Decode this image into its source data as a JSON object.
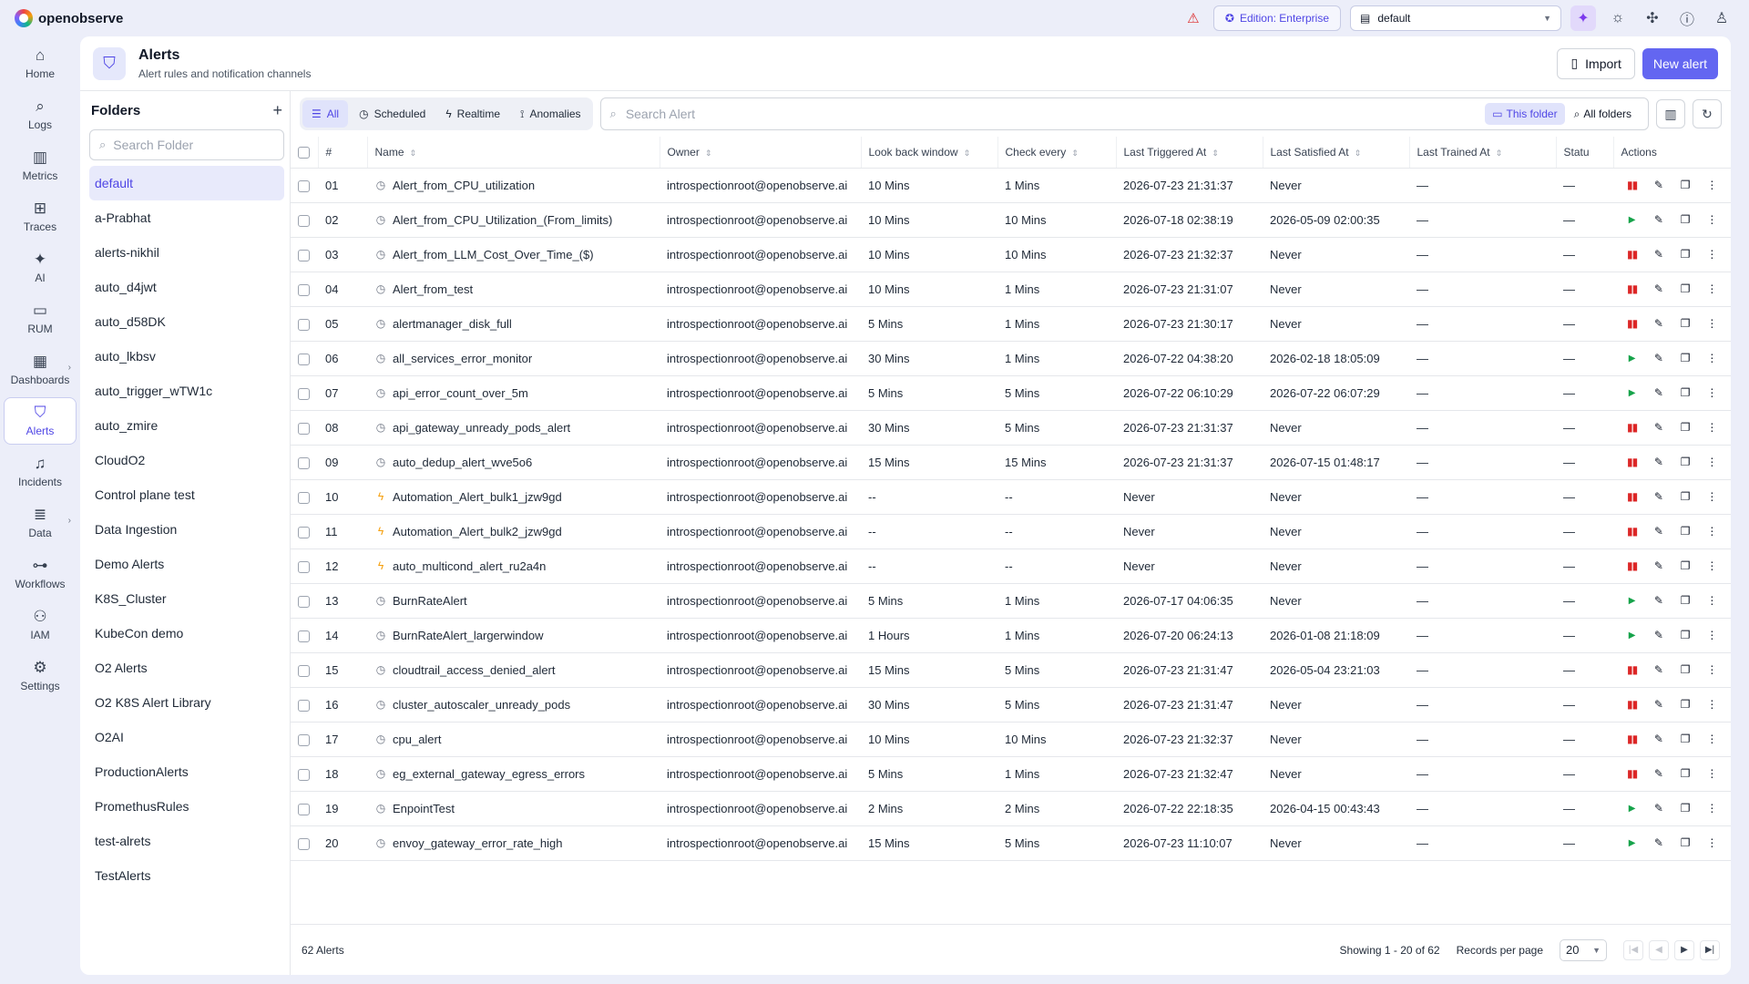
{
  "app": {
    "name": "openobserve"
  },
  "topbar": {
    "edition": "Edition: Enterprise",
    "org": "default"
  },
  "nav": [
    {
      "key": "home",
      "label": "Home",
      "icon": "home-icon",
      "glyph": "⌂",
      "active": false,
      "more": false
    },
    {
      "key": "logs",
      "label": "Logs",
      "icon": "search-icon",
      "glyph": "⌕",
      "active": false,
      "more": false
    },
    {
      "key": "metrics",
      "label": "Metrics",
      "icon": "bar-chart-icon",
      "glyph": "▥",
      "active": false,
      "more": false
    },
    {
      "key": "traces",
      "label": "Traces",
      "icon": "traces-icon",
      "glyph": "⊞",
      "active": false,
      "more": false
    },
    {
      "key": "ai",
      "label": "AI",
      "icon": "sparkle-icon",
      "glyph": "✦",
      "active": false,
      "more": false
    },
    {
      "key": "rum",
      "label": "RUM",
      "icon": "devices-icon",
      "glyph": "▭",
      "active": false,
      "more": false
    },
    {
      "key": "dashboards",
      "label": "Dashboards",
      "icon": "dashboard-icon",
      "glyph": "▦",
      "active": false,
      "more": true
    },
    {
      "key": "alerts",
      "label": "Alerts",
      "icon": "shield-icon",
      "glyph": "⛉",
      "active": true,
      "more": false
    },
    {
      "key": "incidents",
      "label": "Incidents",
      "icon": "bell-icon",
      "glyph": "♫",
      "active": false,
      "more": false
    },
    {
      "key": "data",
      "label": "Data",
      "icon": "database-icon",
      "glyph": "≣",
      "active": false,
      "more": true
    },
    {
      "key": "workflows",
      "label": "Workflows",
      "icon": "workflow-icon",
      "glyph": "⊶",
      "active": false,
      "more": false
    },
    {
      "key": "iam",
      "label": "IAM",
      "icon": "users-icon",
      "glyph": "⚇",
      "active": false,
      "more": false
    },
    {
      "key": "settings",
      "label": "Settings",
      "icon": "gear-icon",
      "glyph": "⚙",
      "active": false,
      "more": false
    }
  ],
  "header": {
    "title": "Alerts",
    "subtitle": "Alert rules and notification channels",
    "import_label": "Import",
    "new_label": "New alert"
  },
  "folders": {
    "title": "Folders",
    "search_placeholder": "Search Folder",
    "items": [
      "default",
      "a-Prabhat",
      "alerts-nikhil",
      "auto_d4jwt",
      "auto_d58DK",
      "auto_lkbsv",
      "auto_trigger_wTW1c",
      "auto_zmire",
      "CloudO2",
      "Control plane test",
      "Data Ingestion",
      "Demo Alerts",
      "K8S_Cluster",
      "KubeCon demo",
      "O2 Alerts",
      "O2 K8S Alert Library",
      "O2AI",
      "ProductionAlerts",
      "PromethusRules",
      "test-alrets",
      "TestAlerts"
    ],
    "selected": "default"
  },
  "toolbar": {
    "tabs": [
      {
        "label": "All",
        "icon": "list-icon",
        "glyph": "☰",
        "active": true
      },
      {
        "label": "Scheduled",
        "icon": "clock-icon",
        "glyph": "◷",
        "active": false
      },
      {
        "label": "Realtime",
        "icon": "bolt-icon",
        "glyph": "ϟ",
        "active": false
      },
      {
        "label": "Anomalies",
        "icon": "anomaly-icon",
        "glyph": "⟟",
        "active": false
      }
    ],
    "search_placeholder": "Search Alert",
    "scope_this": "This folder",
    "scope_all": "All folders"
  },
  "table": {
    "headers": {
      "num": "#",
      "name": "Name",
      "owner": "Owner",
      "lookback": "Look back window",
      "check": "Check every",
      "triggered": "Last Triggered At",
      "satisfied": "Last Satisfied At",
      "trained": "Last Trained At",
      "status": "Statu",
      "actions": "Actions"
    },
    "rows": [
      {
        "num": "01",
        "type": "scheduled",
        "name": "Alert_from_CPU_utilization",
        "owner": "introspectionroot@openobserve.ai",
        "lookback": "10 Mins",
        "check": "1 Mins",
        "triggered": "2026-07-23 21:31:37",
        "satisfied": "Never",
        "trained": "—",
        "status": "—",
        "state": "running"
      },
      {
        "num": "02",
        "type": "scheduled",
        "name": "Alert_from_CPU_Utilization_(From_limits)",
        "owner": "introspectionroot@openobserve.ai",
        "lookback": "10 Mins",
        "check": "10 Mins",
        "triggered": "2026-07-18 02:38:19",
        "satisfied": "2026-05-09 02:00:35",
        "trained": "—",
        "status": "—",
        "state": "paused"
      },
      {
        "num": "03",
        "type": "scheduled",
        "name": "Alert_from_LLM_Cost_Over_Time_($)",
        "owner": "introspectionroot@openobserve.ai",
        "lookback": "10 Mins",
        "check": "10 Mins",
        "triggered": "2026-07-23 21:32:37",
        "satisfied": "Never",
        "trained": "—",
        "status": "—",
        "state": "running"
      },
      {
        "num": "04",
        "type": "scheduled",
        "name": "Alert_from_test",
        "owner": "introspectionroot@openobserve.ai",
        "lookback": "10 Mins",
        "check": "1 Mins",
        "triggered": "2026-07-23 21:31:07",
        "satisfied": "Never",
        "trained": "—",
        "status": "—",
        "state": "running"
      },
      {
        "num": "05",
        "type": "scheduled",
        "name": "alertmanager_disk_full",
        "owner": "introspectionroot@openobserve.ai",
        "lookback": "5 Mins",
        "check": "1 Mins",
        "triggered": "2026-07-23 21:30:17",
        "satisfied": "Never",
        "trained": "—",
        "status": "—",
        "state": "running"
      },
      {
        "num": "06",
        "type": "scheduled",
        "name": "all_services_error_monitor",
        "owner": "introspectionroot@openobserve.ai",
        "lookback": "30 Mins",
        "check": "1 Mins",
        "triggered": "2026-07-22 04:38:20",
        "satisfied": "2026-02-18 18:05:09",
        "trained": "—",
        "status": "—",
        "state": "paused"
      },
      {
        "num": "07",
        "type": "scheduled",
        "name": "api_error_count_over_5m",
        "owner": "introspectionroot@openobserve.ai",
        "lookback": "5 Mins",
        "check": "5 Mins",
        "triggered": "2026-07-22 06:10:29",
        "satisfied": "2026-07-22 06:07:29",
        "trained": "—",
        "status": "—",
        "state": "paused"
      },
      {
        "num": "08",
        "type": "scheduled",
        "name": "api_gateway_unready_pods_alert",
        "owner": "introspectionroot@openobserve.ai",
        "lookback": "30 Mins",
        "check": "5 Mins",
        "triggered": "2026-07-23 21:31:37",
        "satisfied": "Never",
        "trained": "—",
        "status": "—",
        "state": "running"
      },
      {
        "num": "09",
        "type": "scheduled",
        "name": "auto_dedup_alert_wve5o6",
        "owner": "introspectionroot@openobserve.ai",
        "lookback": "15 Mins",
        "check": "15 Mins",
        "triggered": "2026-07-23 21:31:37",
        "satisfied": "2026-07-15 01:48:17",
        "trained": "—",
        "status": "—",
        "state": "running"
      },
      {
        "num": "10",
        "type": "realtime",
        "name": "Automation_Alert_bulk1_jzw9gd",
        "owner": "introspectionroot@openobserve.ai",
        "lookback": "--",
        "check": "--",
        "triggered": "Never",
        "satisfied": "Never",
        "trained": "—",
        "status": "—",
        "state": "running"
      },
      {
        "num": "11",
        "type": "realtime",
        "name": "Automation_Alert_bulk2_jzw9gd",
        "owner": "introspectionroot@openobserve.ai",
        "lookback": "--",
        "check": "--",
        "triggered": "Never",
        "satisfied": "Never",
        "trained": "—",
        "status": "—",
        "state": "running"
      },
      {
        "num": "12",
        "type": "realtime",
        "name": "auto_multicond_alert_ru2a4n",
        "owner": "introspectionroot@openobserve.ai",
        "lookback": "--",
        "check": "--",
        "triggered": "Never",
        "satisfied": "Never",
        "trained": "—",
        "status": "—",
        "state": "running"
      },
      {
        "num": "13",
        "type": "scheduled",
        "name": "BurnRateAlert",
        "owner": "introspectionroot@openobserve.ai",
        "lookback": "5 Mins",
        "check": "1 Mins",
        "triggered": "2026-07-17 04:06:35",
        "satisfied": "Never",
        "trained": "—",
        "status": "—",
        "state": "paused"
      },
      {
        "num": "14",
        "type": "scheduled",
        "name": "BurnRateAlert_largerwindow",
        "owner": "introspectionroot@openobserve.ai",
        "lookback": "1 Hours",
        "check": "1 Mins",
        "triggered": "2026-07-20 06:24:13",
        "satisfied": "2026-01-08 21:18:09",
        "trained": "—",
        "status": "—",
        "state": "paused"
      },
      {
        "num": "15",
        "type": "scheduled",
        "name": "cloudtrail_access_denied_alert",
        "owner": "introspectionroot@openobserve.ai",
        "lookback": "15 Mins",
        "check": "5 Mins",
        "triggered": "2026-07-23 21:31:47",
        "satisfied": "2026-05-04 23:21:03",
        "trained": "—",
        "status": "—",
        "state": "running"
      },
      {
        "num": "16",
        "type": "scheduled",
        "name": "cluster_autoscaler_unready_pods",
        "owner": "introspectionroot@openobserve.ai",
        "lookback": "30 Mins",
        "check": "5 Mins",
        "triggered": "2026-07-23 21:31:47",
        "satisfied": "Never",
        "trained": "—",
        "status": "—",
        "state": "running"
      },
      {
        "num": "17",
        "type": "scheduled",
        "name": "cpu_alert",
        "owner": "introspectionroot@openobserve.ai",
        "lookback": "10 Mins",
        "check": "10 Mins",
        "triggered": "2026-07-23 21:32:37",
        "satisfied": "Never",
        "trained": "—",
        "status": "—",
        "state": "running"
      },
      {
        "num": "18",
        "type": "scheduled",
        "name": "eg_external_gateway_egress_errors",
        "owner": "introspectionroot@openobserve.ai",
        "lookback": "5 Mins",
        "check": "1 Mins",
        "triggered": "2026-07-23 21:32:47",
        "satisfied": "Never",
        "trained": "—",
        "status": "—",
        "state": "running"
      },
      {
        "num": "19",
        "type": "scheduled",
        "name": "EnpointTest",
        "owner": "introspectionroot@openobserve.ai",
        "lookback": "2 Mins",
        "check": "2 Mins",
        "triggered": "2026-07-22 22:18:35",
        "satisfied": "2026-04-15 00:43:43",
        "trained": "—",
        "status": "—",
        "state": "paused"
      },
      {
        "num": "20",
        "type": "scheduled",
        "name": "envoy_gateway_error_rate_high",
        "owner": "introspectionroot@openobserve.ai",
        "lookback": "15 Mins",
        "check": "5 Mins",
        "triggered": "2026-07-23 11:10:07",
        "satisfied": "Never",
        "trained": "—",
        "status": "—",
        "state": "paused"
      }
    ]
  },
  "footer": {
    "count": "62 Alerts",
    "showing": "Showing 1 - 20 of 62",
    "per_page_label": "Records per page",
    "per_page": "20"
  },
  "colors": {
    "accent": "#6366f1",
    "pause": "#dc2626",
    "play": "#16a34a",
    "realtime": "#f59e0b"
  }
}
